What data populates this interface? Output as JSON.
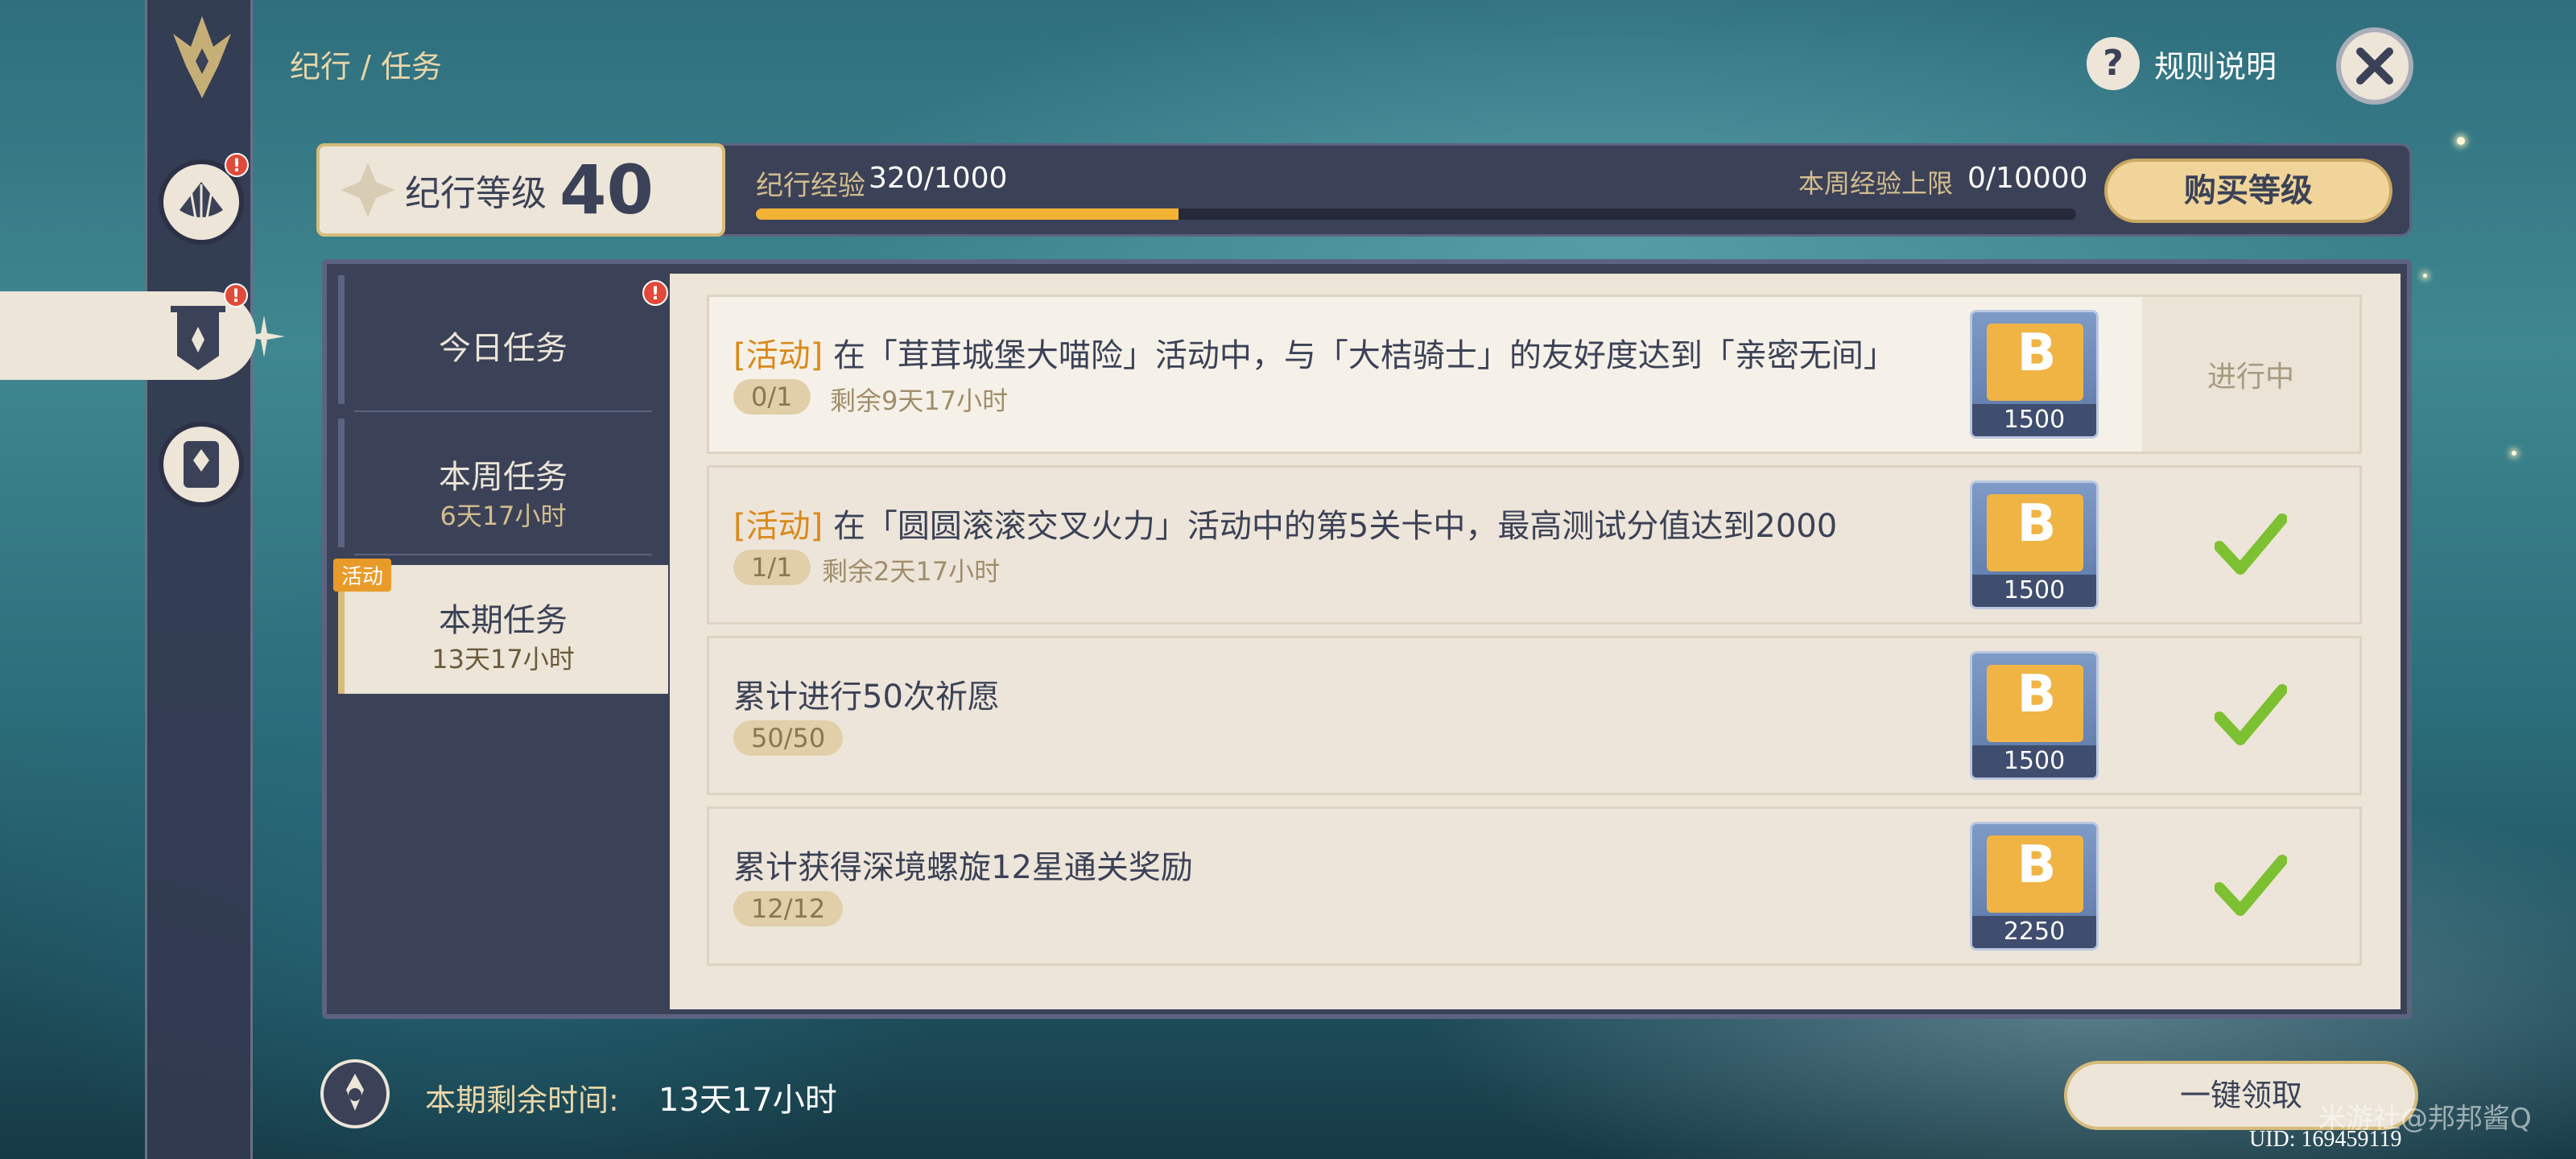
{
  "header": {
    "breadcrumb": "纪行 / 任务",
    "help_label": "规则说明",
    "help_icon": "?"
  },
  "level": {
    "label": "纪行等级",
    "value": "40",
    "exp_label": "纪行经验",
    "exp_value": "320/1000",
    "exp_progress": 0.32,
    "weekly_cap_label": "本周经验上限",
    "weekly_cap_value": "0/10000",
    "buy_button": "购买等级"
  },
  "tabs": [
    {
      "title": "今日任务",
      "sub": "",
      "badge": "!"
    },
    {
      "title": "本周任务",
      "sub": "6天17小时"
    },
    {
      "title": "本期任务",
      "sub": "13天17小时",
      "tag": "活动"
    }
  ],
  "tasks": [
    {
      "tag": "[活动]",
      "title": "在「茸茸城堡大喵险」活动中，与「大桔骑士」的友好度达到「亲密无间」",
      "progress": "0/1",
      "remaining": "剩余9天17小时",
      "reward": "1500",
      "status": "进行中"
    },
    {
      "tag": "[活动]",
      "title": "在「圆圆滚滚交叉火力」活动中的第5关卡中，最高测试分值达到2000",
      "progress": "1/1",
      "remaining": "剩余2天17小时",
      "reward": "1500",
      "status": "done"
    },
    {
      "tag": "",
      "title": "累计进行50次祈愿",
      "progress": "50/50",
      "remaining": "",
      "reward": "1500",
      "status": "done"
    },
    {
      "tag": "",
      "title": "累计获得深境螺旋12星通关奖励",
      "progress": "12/12",
      "remaining": "",
      "reward": "2250",
      "status": "done"
    }
  ],
  "footer": {
    "remaining_label": "本期剩余时间:",
    "remaining_value": "13天17小时",
    "claim_button": "一键领取",
    "uid": "UID: 169459119",
    "watermark": "米游社@邦邦酱Q"
  },
  "colors": {
    "panel_dark": "#3b4257",
    "panel_light": "#ece5d8",
    "gold": "#d6bb7b",
    "progress": "#f2b235",
    "check": "#7dc031",
    "tag_orange": "#d98a1c"
  }
}
